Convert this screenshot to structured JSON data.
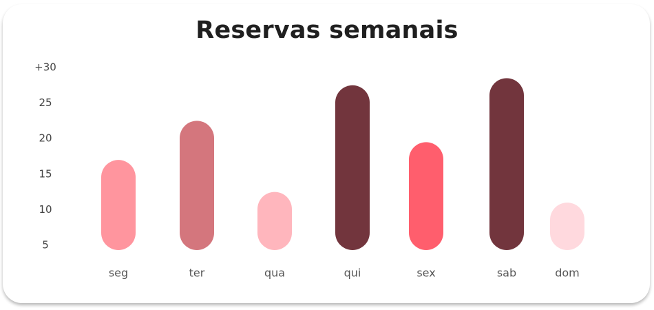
{
  "chart_data": {
    "type": "bar",
    "title": "Reservas semanais",
    "categories": [
      "seg",
      "ter",
      "qua",
      "qui",
      "sex",
      "sab",
      "dom"
    ],
    "values": [
      17,
      22.5,
      12.5,
      27.5,
      19.5,
      28.5,
      11
    ],
    "colors": [
      "#FF959E",
      "#D4767D",
      "#FFB6BD",
      "#72353D",
      "#FF5E6D",
      "#72353D",
      "#FFD9DE"
    ],
    "y_ticks": [
      5,
      10,
      15,
      20,
      25,
      30
    ],
    "y_tick_labels": [
      "5",
      "10",
      "15",
      "20",
      "25",
      "+30"
    ],
    "ylim": [
      5,
      30
    ],
    "xlabel": "",
    "ylabel": "",
    "grid": false,
    "legend": "none",
    "bar_style": "rounded pill"
  }
}
